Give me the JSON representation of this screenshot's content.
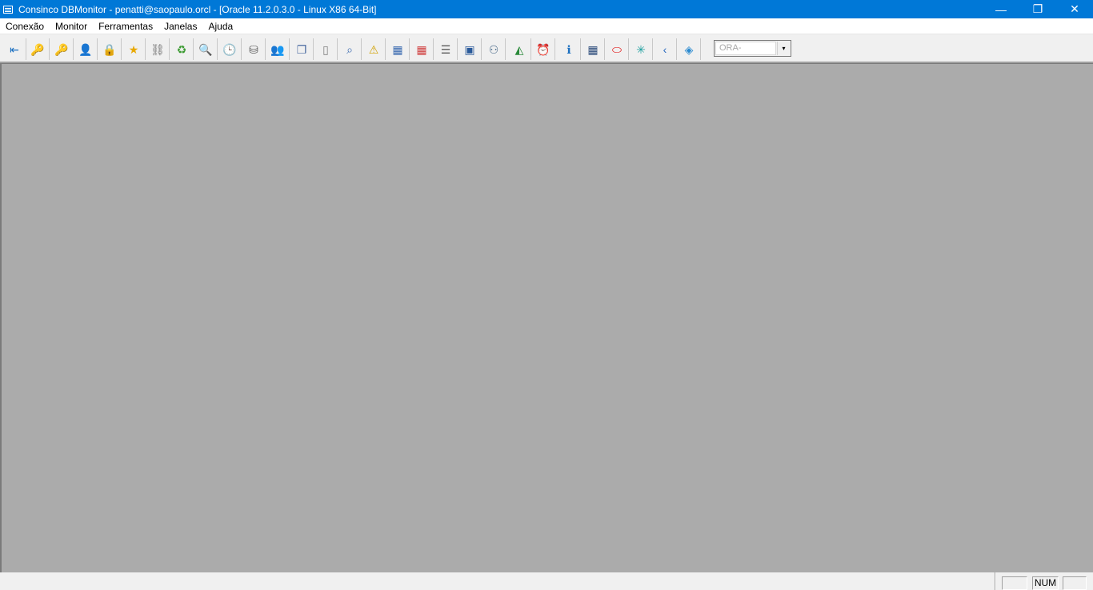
{
  "window": {
    "title": "Consinco DBMonitor - penatti@saopaulo.orcl - [Oracle 11.2.0.3.0 - Linux X86 64-Bit]",
    "minimize_glyph": "—",
    "restore_glyph": "❐",
    "close_glyph": "✕"
  },
  "menu": {
    "items": [
      "Conexão",
      "Monitor",
      "Ferramentas",
      "Janelas",
      "Ajuda"
    ]
  },
  "toolbar": {
    "buttons": [
      {
        "icon": "connect-icon",
        "glyph": "⇤",
        "color": "#1a6fc0"
      },
      {
        "icon": "key-icon",
        "glyph": "🔑",
        "color": "#d8a400"
      },
      {
        "icon": "key-gray-icon",
        "glyph": "🔑",
        "color": "#909090"
      },
      {
        "icon": "user-key-icon",
        "glyph": "👤",
        "color": "#3a7bd5"
      },
      {
        "icon": "lock-icon",
        "glyph": "🔒",
        "color": "#707070"
      },
      {
        "icon": "star-icon",
        "glyph": "★",
        "color": "#e8a800"
      },
      {
        "icon": "chain-icon",
        "glyph": "⛓",
        "color": "#707070"
      },
      {
        "icon": "recycle-icon",
        "glyph": "♻",
        "color": "#3a9a30"
      },
      {
        "icon": "search-db-icon",
        "glyph": "🔍",
        "color": "#5a7a9a"
      },
      {
        "icon": "clock-icon",
        "glyph": "🕒",
        "color": "#c08a00"
      },
      {
        "icon": "database-icon",
        "glyph": "⛁",
        "color": "#606060"
      },
      {
        "icon": "users-icon",
        "glyph": "👥",
        "color": "#c03a20"
      },
      {
        "icon": "copy-icon",
        "glyph": "❐",
        "color": "#4a6aa0"
      },
      {
        "icon": "page-icon",
        "glyph": "▯",
        "color": "#808080"
      },
      {
        "icon": "find-page-icon",
        "glyph": "⌕",
        "color": "#3a6ab0"
      },
      {
        "icon": "warning-page-icon",
        "glyph": "⚠",
        "color": "#d0a000"
      },
      {
        "icon": "grid-icon",
        "glyph": "▦",
        "color": "#3a6ab0"
      },
      {
        "icon": "calendar-icon",
        "glyph": "▦",
        "color": "#d04040"
      },
      {
        "icon": "list-icon",
        "glyph": "☰",
        "color": "#5a5a5a"
      },
      {
        "icon": "save-grid-icon",
        "glyph": "▣",
        "color": "#2a5a9a"
      },
      {
        "icon": "people-search-icon",
        "glyph": "⚇",
        "color": "#4a6a8a"
      },
      {
        "icon": "chart-icon",
        "glyph": "◭",
        "color": "#2a8a3a"
      },
      {
        "icon": "alarm-icon",
        "glyph": "⏰",
        "color": "#c03030"
      },
      {
        "icon": "info-icon",
        "glyph": "ℹ",
        "color": "#1a6fc0"
      },
      {
        "icon": "calculator-icon",
        "glyph": "▦",
        "color": "#2a4a7a"
      },
      {
        "icon": "oracle-icon",
        "glyph": "⬭",
        "color": "#e00000"
      },
      {
        "icon": "spark-icon",
        "glyph": "✳",
        "color": "#20a0a0"
      },
      {
        "icon": "back-arrow-icon",
        "glyph": "‹",
        "color": "#2a6ac0"
      },
      {
        "icon": "book-icon",
        "glyph": "◈",
        "color": "#2a8ad0"
      }
    ],
    "combo": {
      "value": "ORA-",
      "arrow": "▾"
    }
  },
  "statusbar": {
    "panel1": "",
    "panel2": "NUM",
    "panel3": ""
  }
}
